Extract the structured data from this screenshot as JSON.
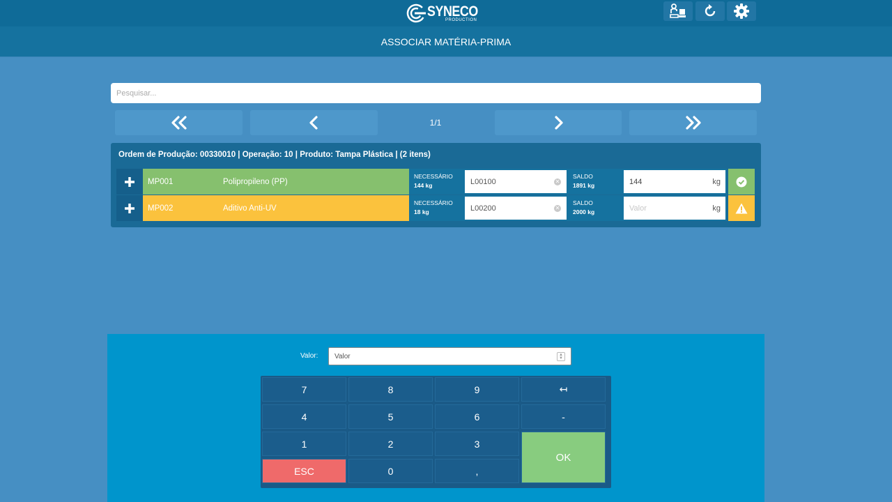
{
  "app": {
    "logo_name": "SYNECO",
    "logo_sub": "PRODUCTION",
    "screen_title": "ASSOCIAR MATÉRIA-PRIMA"
  },
  "toolbar": {
    "icons": [
      "operator-workstation-icon",
      "refresh-icon",
      "gear-icon"
    ]
  },
  "search": {
    "placeholder": "Pesquisar..."
  },
  "pagination": {
    "label": "1/1"
  },
  "order": {
    "header": "Ordem de Produção: 00330010 | Operação: 10 | Produto: Tampa Plástica | (2 itens)",
    "items": [
      {
        "code": "MP001",
        "description": "Polipropileno (PP)",
        "need_label": "NECESSÁRIO",
        "need_value": "144 kg",
        "lot": "L00100",
        "balance_label": "SALDO",
        "balance_value": "1891 kg",
        "amount": "144",
        "amount_placeholder": "Valor",
        "unit": "kg",
        "status": "ok",
        "color": "#86c06e",
        "status_color": "#86c06e"
      },
      {
        "code": "MP002",
        "description": "Aditivo Anti-UV",
        "need_label": "NECESSÁRIO",
        "need_value": "18 kg",
        "lot": "L00200",
        "balance_label": "SALDO",
        "balance_value": "2000 kg",
        "amount": "",
        "amount_placeholder": "Valor",
        "unit": "kg",
        "status": "warning",
        "color": "#fbc23d",
        "status_color": "#fbc23d"
      }
    ]
  },
  "keypad": {
    "value_label": "Valor:",
    "value_placeholder": "Valor",
    "keys": {
      "k7": "7",
      "k8": "8",
      "k9": "9",
      "tab": "↤",
      "k4": "4",
      "k5": "5",
      "k6": "6",
      "minus": "-",
      "k1": "1",
      "k2": "2",
      "k3": "3",
      "esc": "ESC",
      "k0": "0",
      "comma": ",",
      "ok": "OK"
    }
  },
  "colors": {
    "background": "#468fc3",
    "topbar": "#0f6b98",
    "keypad_panel": "#0095cc",
    "esc": "#ef6a6a",
    "ok": "#88cc7f"
  }
}
